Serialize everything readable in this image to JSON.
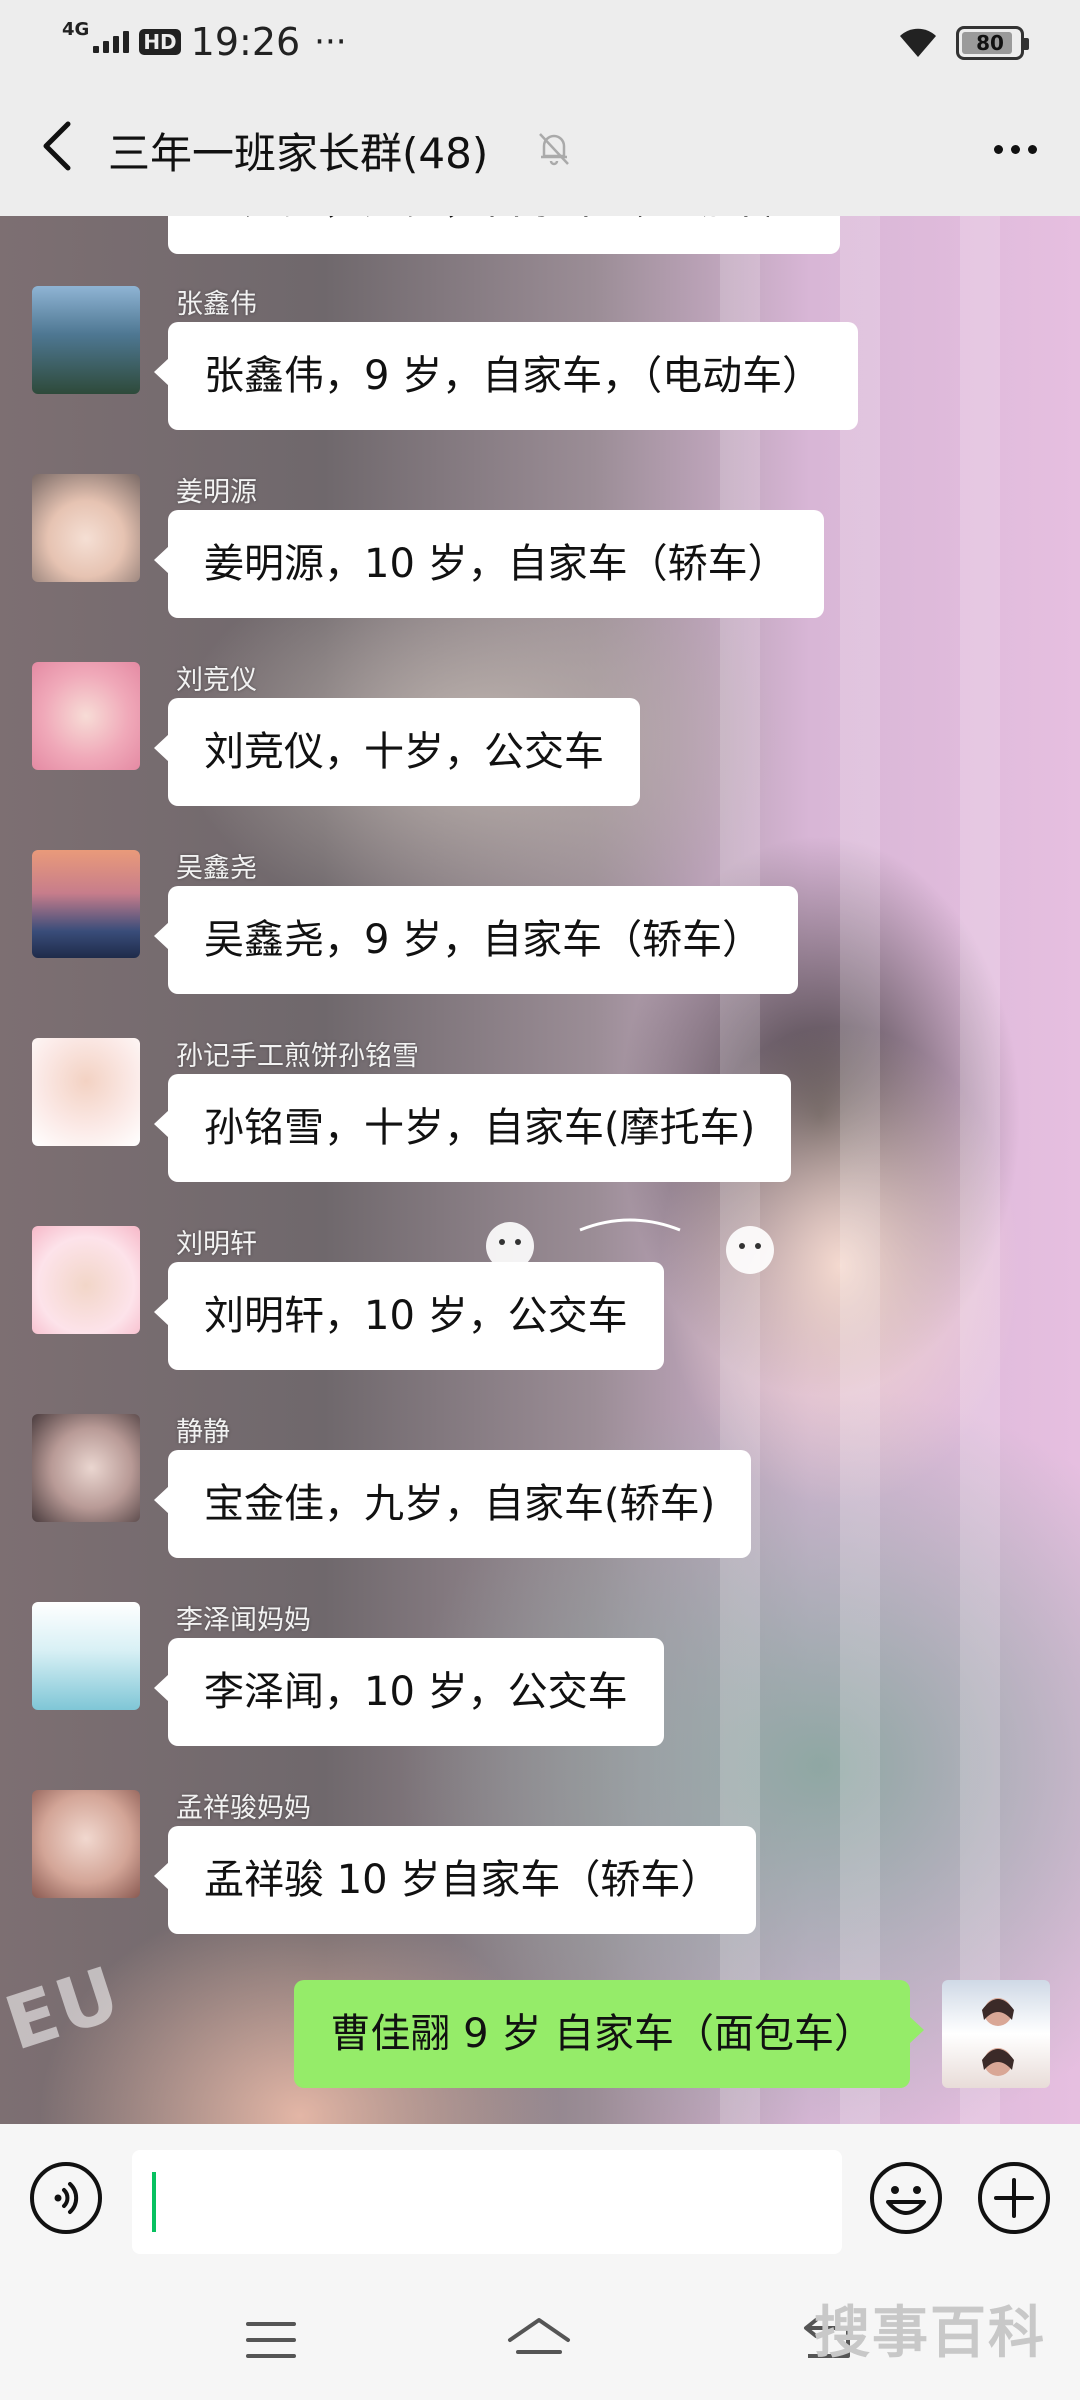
{
  "status_bar": {
    "network": "4G",
    "hd": "HD",
    "time": "19:26",
    "more": "···",
    "battery": "80"
  },
  "header": {
    "title": "三年一班家长群(48)",
    "back_icon": "chevron-left-icon",
    "mute_icon": "bell-muted-icon",
    "more_icon": "more-dots-icon"
  },
  "messages": [
    {
      "sender": "张鑫伟",
      "text": "张鑫伟，9 岁，自家车，（电动车）",
      "avatar_colors": [
        "#6a8fb0",
        "#2e4a3a"
      ]
    },
    {
      "sender": "姜明源",
      "text": "姜明源，10 岁，自家车（轿车）",
      "avatar_colors": [
        "#f3e7e1",
        "#c9a996"
      ]
    },
    {
      "sender": "刘竞仪",
      "text": "刘竞仪，十岁，公交车",
      "avatar_colors": [
        "#f6c4cf",
        "#e48aa3"
      ]
    },
    {
      "sender": "吴鑫尧",
      "text": "吴鑫尧，9 岁，自家车（轿车）",
      "avatar_colors": [
        "#e99a7a",
        "#2a3f66"
      ]
    },
    {
      "sender": "孙记手工煎饼孙铭雪",
      "text": "孙铭雪，十岁，自家车(摩托车)",
      "avatar_colors": [
        "#fbe9e6",
        "#d9b3a4"
      ]
    },
    {
      "sender": "刘明轩",
      "text": "刘明轩，10 岁，公交车",
      "avatar_colors": [
        "#fde3ea",
        "#d4a99b"
      ]
    },
    {
      "sender": "静静",
      "text": "宝金佳，九岁，自家车(轿车)",
      "avatar_colors": [
        "#e8d2cf",
        "#5a4a4c"
      ]
    },
    {
      "sender": "李泽闻妈妈",
      "text": "李泽闻，10 岁，公交车",
      "avatar_colors": [
        "#bfe6ef",
        "#7fc6d6"
      ]
    },
    {
      "sender": "孟祥骏妈妈",
      "text": "孟祥骏 10 岁自家车（轿车）",
      "avatar_colors": [
        "#f1d8cf",
        "#b87a6b"
      ]
    }
  ],
  "self_message": {
    "text": "曹佳翮 9 岁 自家车（面包车）"
  },
  "partial_top_text": "王广鑫，九岁，自家车（电动车）",
  "background_text": "EU",
  "input_bar": {
    "value": "",
    "voice_icon": "voice-icon",
    "emoji_icon": "emoji-icon",
    "plus_icon": "plus-icon"
  },
  "nav_bar": {
    "menu_icon": "menu-icon",
    "home_icon": "home-icon",
    "back_icon": "back-arrow-icon",
    "watermark": "搜事百科"
  },
  "colors": {
    "bubble_other": "#ffffff",
    "bubble_self": "#95ec69",
    "caret": "#07c160"
  }
}
